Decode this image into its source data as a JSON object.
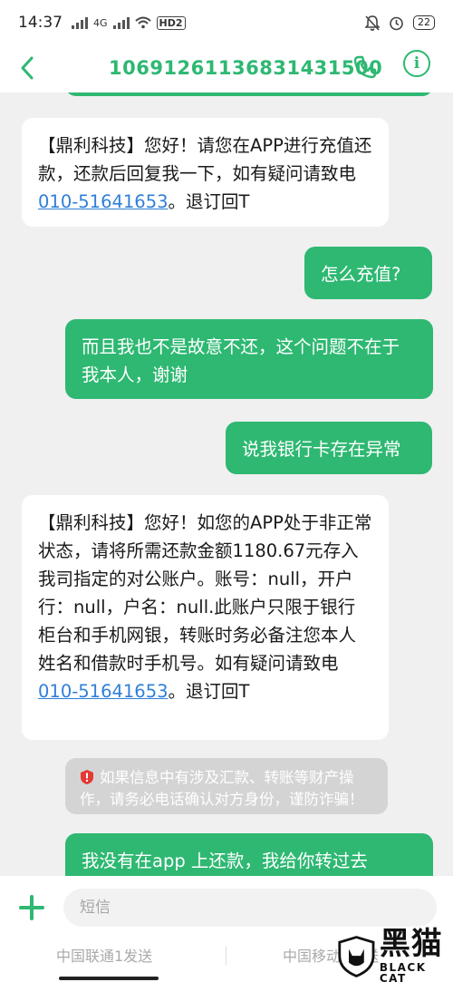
{
  "status_bar": {
    "time": "14:37",
    "network_label": "4G",
    "hd_label": "HD2",
    "battery": "22"
  },
  "header": {
    "title": "10691261136831431500"
  },
  "messages": [
    {
      "direction": "incoming",
      "parts": [
        {
          "text": "【鼎利科技】您好！请您在APP进行充值还款，还款后回复我一下，如有疑问请致电"
        },
        {
          "text": "010-51641653",
          "link": true
        },
        {
          "text": "。退订回T"
        }
      ]
    },
    {
      "direction": "outgoing",
      "parts": [
        {
          "text": "怎么充值?"
        }
      ]
    },
    {
      "direction": "outgoing",
      "parts": [
        {
          "text": "而且我也不是故意不还，这个问题不在于我本人，谢谢"
        }
      ]
    },
    {
      "direction": "outgoing",
      "parts": [
        {
          "text": "说我银行卡存在异常"
        }
      ]
    },
    {
      "direction": "incoming",
      "parts": [
        {
          "text": "【鼎利科技】您好！如您的APP处于非正常状态，请将所需还款金额1180.67元存入我司指定的对公账户。账号：null，开户行：null，户名：null.此账户只限于银行柜台和手机网银，转账时务必备注您本人姓名和借款时手机号。如有疑问请致电"
        },
        {
          "text": "010-51641653",
          "link": true
        },
        {
          "text": "。退订回T"
        }
      ]
    },
    {
      "direction": "outgoing",
      "parts": [
        {
          "text": "我没有在app 上还款，我给你转过去"
        }
      ]
    }
  ],
  "warning": {
    "text": "如果信息中有涉及汇款、转账等财产操作，请务必电话确认对方身份，谨防诈骗！"
  },
  "composer": {
    "placeholder": "短信",
    "send_sim1": "中国联通1发送",
    "send_sim2": "中国移动2发送"
  },
  "watermark": {
    "cn": "黑猫",
    "en": "BLACK CAT"
  },
  "colors": {
    "accent": "#2eb872",
    "link": "#2f7fd8",
    "incoming_bg": "#ffffff",
    "warning_bg": "#d4d4d4",
    "background": "#f0f0f0"
  }
}
